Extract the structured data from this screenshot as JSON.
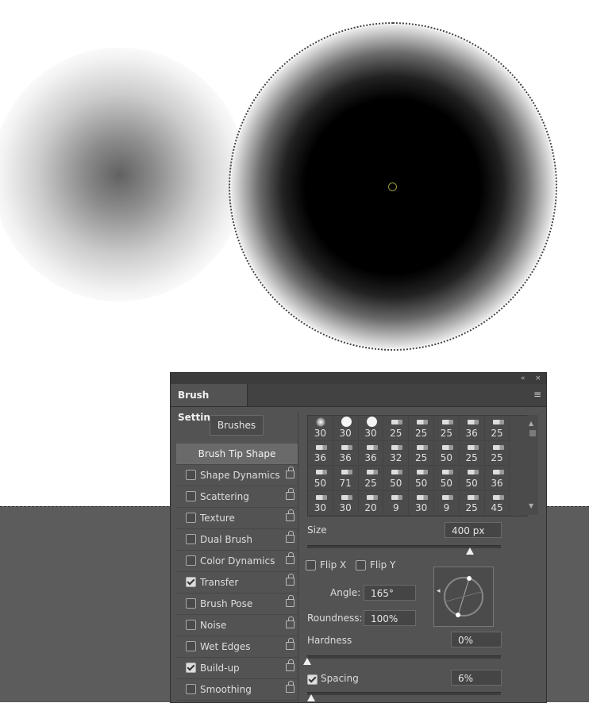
{
  "icons": {
    "collapse": "«",
    "close": "×",
    "menu": "≡",
    "scroll_up": "▲",
    "scroll_down": "▼",
    "angle_pointer": "◂"
  },
  "panel": {
    "tab_title": "Brush Settings",
    "brushes_button": "Brushes"
  },
  "left_list": [
    {
      "label": "Brush Tip Shape",
      "active": true
    },
    {
      "label": "Shape Dynamics",
      "checked": false,
      "lock": true
    },
    {
      "label": "Scattering",
      "checked": false,
      "lock": true
    },
    {
      "label": "Texture",
      "checked": false,
      "lock": true
    },
    {
      "label": "Dual Brush",
      "checked": false,
      "lock": true
    },
    {
      "label": "Color Dynamics",
      "checked": false,
      "lock": true
    },
    {
      "label": "Transfer",
      "checked": true,
      "lock": true
    },
    {
      "label": "Brush Pose",
      "checked": false,
      "lock": true
    },
    {
      "label": "Noise",
      "checked": false,
      "lock": true
    },
    {
      "label": "Wet Edges",
      "checked": false,
      "lock": true
    },
    {
      "label": "Build-up",
      "checked": true,
      "lock": true
    },
    {
      "label": "Smoothing",
      "checked": false,
      "lock": true
    }
  ],
  "presets": [
    {
      "size": "30",
      "kind": "soft"
    },
    {
      "size": "30",
      "kind": "hard"
    },
    {
      "size": "30",
      "kind": "hard"
    },
    {
      "size": "25",
      "kind": "tool"
    },
    {
      "size": "25",
      "kind": "tool"
    },
    {
      "size": "25",
      "kind": "tool"
    },
    {
      "size": "36",
      "kind": "tool"
    },
    {
      "size": "25",
      "kind": "tool"
    },
    {
      "size": "36",
      "kind": "tool"
    },
    {
      "size": "36",
      "kind": "tool"
    },
    {
      "size": "36",
      "kind": "tool"
    },
    {
      "size": "32",
      "kind": "tool"
    },
    {
      "size": "25",
      "kind": "tool"
    },
    {
      "size": "50",
      "kind": "tool"
    },
    {
      "size": "25",
      "kind": "tool"
    },
    {
      "size": "25",
      "kind": "tool"
    },
    {
      "size": "50",
      "kind": "tool"
    },
    {
      "size": "71",
      "kind": "tool"
    },
    {
      "size": "25",
      "kind": "tool"
    },
    {
      "size": "50",
      "kind": "tool"
    },
    {
      "size": "50",
      "kind": "tool"
    },
    {
      "size": "50",
      "kind": "tool"
    },
    {
      "size": "50",
      "kind": "tool"
    },
    {
      "size": "36",
      "kind": "tool"
    },
    {
      "size": "30",
      "kind": "tool"
    },
    {
      "size": "30",
      "kind": "tool"
    },
    {
      "size": "20",
      "kind": "tool"
    },
    {
      "size": "9",
      "kind": "tool"
    },
    {
      "size": "30",
      "kind": "tool"
    },
    {
      "size": "9",
      "kind": "tool"
    },
    {
      "size": "25",
      "kind": "tool"
    },
    {
      "size": "45",
      "kind": "tool"
    }
  ],
  "size": {
    "label": "Size",
    "value": "400 px"
  },
  "flip": {
    "x_label": "Flip X",
    "y_label": "Flip Y"
  },
  "angle": {
    "label": "Angle:",
    "value": "165°"
  },
  "roundness": {
    "label": "Roundness:",
    "value": "100%"
  },
  "hardness": {
    "label": "Hardness",
    "value": "0%"
  },
  "spacing": {
    "label": "Spacing",
    "value": "6%"
  },
  "sliders": {
    "size_fraction": 0.84,
    "hardness_fraction": 0.0,
    "spacing_fraction": 0.02
  }
}
